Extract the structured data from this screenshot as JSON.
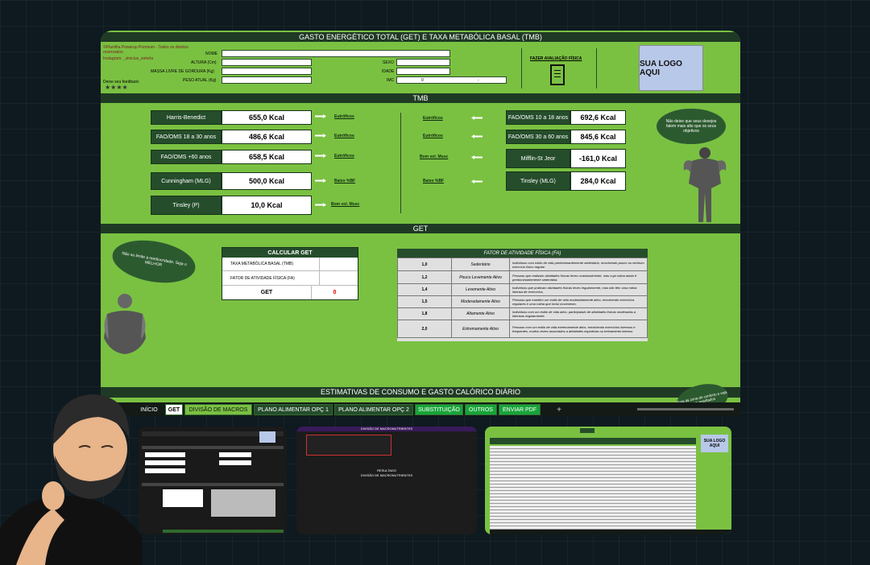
{
  "header": {
    "title": "GASTO ENERGÉTICO TOTAL (GET) E TAXA METABÓLICA BASAL (TMB)",
    "copyright": "©Planilha Powerup Premium - Todos os direitos reservados",
    "instagram": "Instagram: _vinicius_estrela",
    "feedback_label": "Deixe seu feedback:",
    "stars": "★★★★",
    "fields": {
      "nome": "NOME",
      "altura": "ALTURA (Cm)",
      "massa": "MASSA LIVRE DE GORDURA (Kg)",
      "peso": "PESO ATUAL (Kg)",
      "sexo": "SEXO",
      "idade": "IDADE",
      "imc": "IMC",
      "imc_value": "0",
      "imc_class": "-"
    },
    "avaliacao_button": "FAZER AVALIAÇÃO FÍSICA",
    "logo_text": "SUA LOGO AQUI"
  },
  "tmb": {
    "title": "TMB",
    "left": [
      {
        "label": "Harris-Benedict",
        "value": "655,0 Kcal",
        "tag": "Eutróficos"
      },
      {
        "label": "FAO/OMS 18 a 30 anos",
        "value": "486,6 Kcal",
        "tag": "Eutróficos"
      },
      {
        "label": "FAO/OMS +60 anos",
        "value": "658,5 Kcal",
        "tag": "Eutróficos"
      },
      {
        "label": "Cunningham (MLG)",
        "value": "500,0 Kcal",
        "tag": "Baixo %BF"
      },
      {
        "label": "Tinsley (P)",
        "value": "10,0 Kcal",
        "tag": "Bom vol. Musc"
      }
    ],
    "right": [
      {
        "label": "FAO/OMS 10 a 18 anos",
        "value": "692,6 Kcal",
        "tag": "Eutróficos"
      },
      {
        "label": "FAO/OMS 30 a 60 anos",
        "value": "845,6 Kcal",
        "tag": "Eutróficos"
      },
      {
        "label": "Mifflin-St Jeor",
        "value": "-161,0 Kcal",
        "tag": "Bom vol. Musc"
      },
      {
        "label": "Tinsley (MLG)",
        "value": "284,0 Kcal",
        "tag": "Baixo %BF"
      }
    ],
    "quote": "Não deixe que seus desejos falem mais alto que os seus objetivos"
  },
  "get": {
    "title": "GET",
    "quote": "Não se limite à mediocridade. Seja o MELHOR",
    "calc_title": "CALCULAR GET",
    "rows": [
      {
        "label": "TAXA METABÓLICA BASAL (TMB)"
      },
      {
        "label": "FATOR DE ATIVIDADE FÍSICA (FA)"
      }
    ],
    "get_label": "GET",
    "get_value": "0",
    "fa_title": "FATOR DE ATIVIDADE FÍSICA (FA)",
    "fa_rows": [
      {
        "f": "1,0",
        "level": "Sedentário",
        "desc": "Indivíduos com estilo de vida predominantemente sedentário, envolvendo pouco ou nenhum exercício físico regular."
      },
      {
        "f": "1,2",
        "level": "Pouco Levemente Ativo",
        "desc": "Pessoas que realizam atividades físicas leves ocasionalmente, mas cuja rotina ainda é predominantemente sedentária."
      },
      {
        "f": "1,4",
        "level": "Levemente Ativo",
        "desc": "Indivíduos que praticam atividades físicas leves regularmente, mas não têm uma rotina intensa de exercícios."
      },
      {
        "f": "1,5",
        "level": "Moderadamente Ativo",
        "desc": "Pessoas que mantêm um estilo de vida moderadamente ativo, envolvendo exercícios regulares e uma rotina que inclui movimento."
      },
      {
        "f": "1,8",
        "level": "Altamente Ativo",
        "desc": "Indivíduos com um estilo de vida ativo, participando de atividades físicas moderadas a intensas regularmente."
      },
      {
        "f": "2,0",
        "level": "Extremamente Ativo",
        "desc": "Pessoas com um estilo de vida extremamente ativo, envolvendo exercícios intensos e frequentes, muitos vezes associados a atividades esportivas ou treinamento intenso."
      }
    ]
  },
  "estimativas": {
    "title": "ESTIMATIVAS DE CONSUMO E GASTO CALÓRICO DIÁRIO",
    "quote": "Saia da zona de conforto e veja seus resultados"
  },
  "tabs": [
    "INÍCIO",
    "GET",
    "DIVISÃO DE MACROS",
    "PLANO ALIMENTAR OPÇ 1",
    "PLANO ALIMENTAR OPÇ 2",
    "SUBSTITUIÇÃO",
    "OUTROS",
    "ENVIAR PDF",
    "+"
  ],
  "active_tab": "GET",
  "previews": {
    "macros_title": "DIVISÃO DE MACRONUTRIENTES",
    "resultado": "RESULTADO",
    "resultado_sub": "DIVISÃO DE MACRONUTRIENTES",
    "logo_text": "SUA LOGO AQUI"
  },
  "colors": {
    "sheet_green": "#7ac142",
    "dark_green": "#254d2b",
    "header_green": "#1f3a24"
  }
}
